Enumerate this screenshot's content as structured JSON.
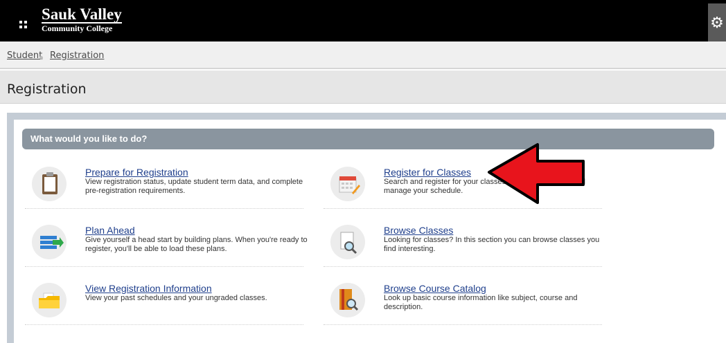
{
  "header": {
    "logo_line1": "Sauk Valley",
    "logo_line2": "Community College"
  },
  "breadcrumb": {
    "items": [
      "Student",
      "Registration"
    ]
  },
  "page": {
    "title": "Registration"
  },
  "panel": {
    "header": "What would you like to do?",
    "tasks": [
      {
        "title": "Prepare for Registration",
        "desc": "View registration status, update student term data, and complete pre-registration requirements.",
        "icon": "clipboard-icon"
      },
      {
        "title": "Register for Classes",
        "desc": "Search and register for your classes. You can also view and manage your schedule.",
        "icon": "calendar-pencil-icon"
      },
      {
        "title": "Plan Ahead",
        "desc": "Give yourself a head start by building plans. When you're ready to register, you'll be able to load these plans.",
        "icon": "plan-list-icon"
      },
      {
        "title": "Browse Classes",
        "desc": "Looking for classes? In this section you can browse classes you find interesting.",
        "icon": "magnifier-document-icon"
      },
      {
        "title": "View Registration Information",
        "desc": "View your past schedules and your ungraded classes.",
        "icon": "folder-icon"
      },
      {
        "title": "Browse Course Catalog",
        "desc": "Look up basic course information like subject, course and description.",
        "icon": "book-magnifier-icon"
      }
    ]
  },
  "colors": {
    "annotation_arrow": "#e8141c",
    "link": "#1f3f8c",
    "section_header": "#8a959f"
  }
}
